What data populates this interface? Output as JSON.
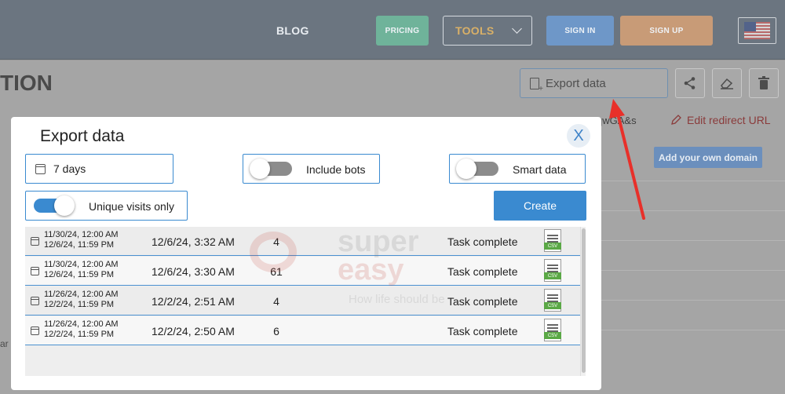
{
  "nav": {
    "blog": "BLOG",
    "pricing": "PRICING",
    "tools": "TOOLS",
    "sign_in": "SIGN IN",
    "sign_up": "SIGN UP"
  },
  "page": {
    "title": "TION",
    "export_label": "Export data",
    "slug": "qwGA&s",
    "edit_redirect": "Edit redirect URL",
    "add_domain": "Add your own domain",
    "left_fragment": "ar"
  },
  "modal": {
    "title": "Export data",
    "close": "X",
    "days": "7 days",
    "include_bots": "Include bots",
    "smart_data": "Smart data",
    "unique_visits": "Unique visits only",
    "create": "Create",
    "rows": [
      {
        "from": "11/30/24, 12:00 AM",
        "to": "12/6/24, 11:59 PM",
        "created": "12/6/24, 3:32 AM",
        "count": "4",
        "status": "Task complete",
        "file": "CSV"
      },
      {
        "from": "11/30/24, 12:00 AM",
        "to": "12/6/24, 11:59 PM",
        "created": "12/6/24, 3:30 AM",
        "count": "61",
        "status": "Task complete",
        "file": "CSV"
      },
      {
        "from": "11/26/24, 12:00 AM",
        "to": "12/2/24, 11:59 PM",
        "created": "12/2/24, 2:51 AM",
        "count": "4",
        "status": "Task complete",
        "file": "CSV"
      },
      {
        "from": "11/26/24, 12:00 AM",
        "to": "12/2/24, 11:59 PM",
        "created": "12/2/24, 2:50 AM",
        "count": "6",
        "status": "Task complete",
        "file": "CSV"
      }
    ]
  },
  "watermark": {
    "line1": "super",
    "line2": "easy",
    "tagline": "How life should be"
  },
  "colors": {
    "accent": "#3a8ad0",
    "csv_green": "#5aa845",
    "annotation_red": "#e8302a"
  }
}
